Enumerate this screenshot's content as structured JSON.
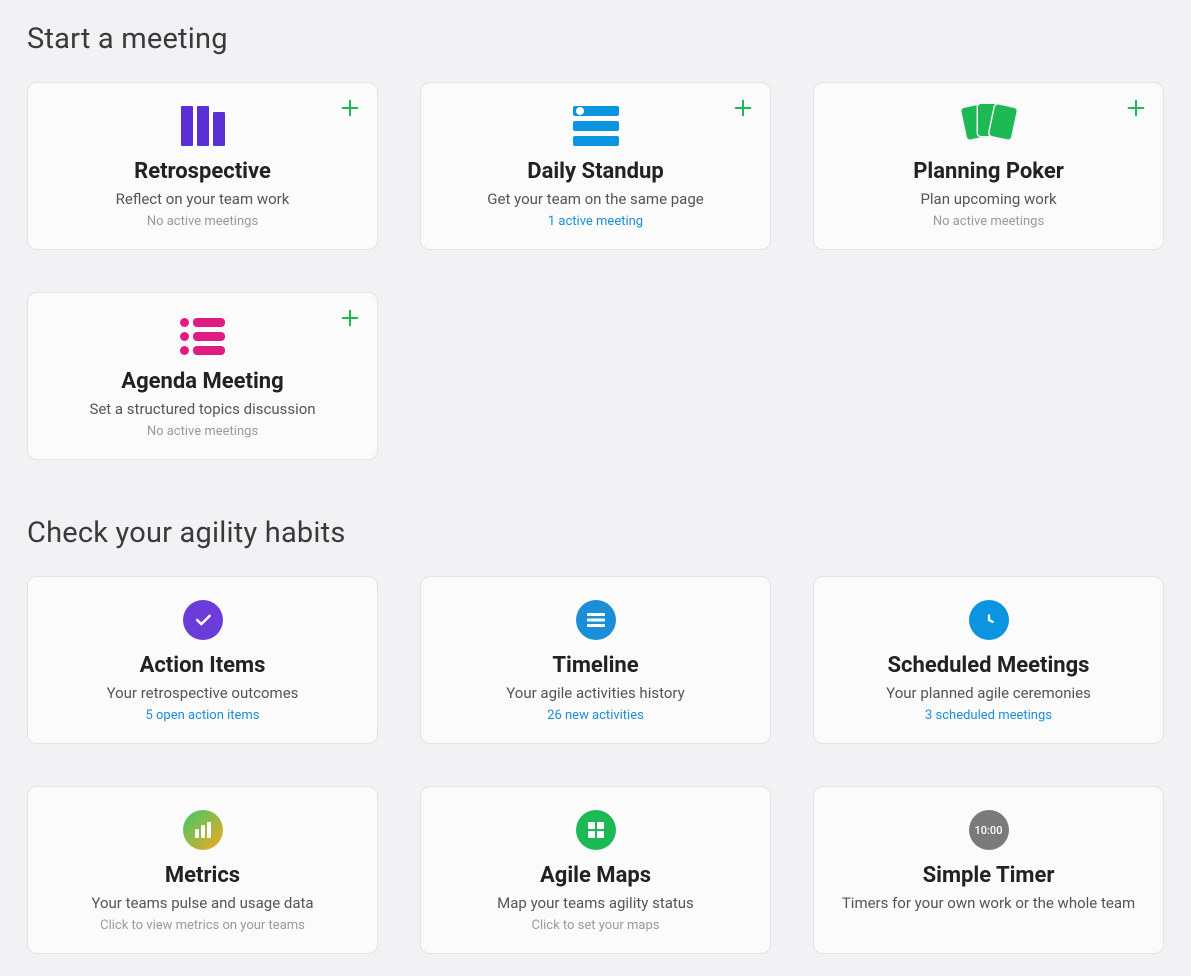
{
  "sections": {
    "start": {
      "title": "Start a meeting",
      "cards": [
        {
          "title": "Retrospective",
          "subtitle": "Reflect on your team work",
          "meta": "No active meetings",
          "meta_link": false
        },
        {
          "title": "Daily Standup",
          "subtitle": "Get your team on the same page",
          "meta": "1 active meeting",
          "meta_link": true
        },
        {
          "title": "Planning Poker",
          "subtitle": "Plan upcoming work",
          "meta": "No active meetings",
          "meta_link": false
        },
        {
          "title": "Agenda Meeting",
          "subtitle": "Set a structured topics discussion",
          "meta": "No active meetings",
          "meta_link": false
        }
      ]
    },
    "habits": {
      "title": "Check your agility habits",
      "cards": [
        {
          "title": "Action Items",
          "subtitle": "Your retrospective outcomes",
          "meta": "5 open action items",
          "meta_link": true
        },
        {
          "title": "Timeline",
          "subtitle": "Your agile activities history",
          "meta": "26 new activities",
          "meta_link": true
        },
        {
          "title": "Scheduled Meetings",
          "subtitle": "Your planned agile ceremonies",
          "meta": "3 scheduled meetings",
          "meta_link": true
        },
        {
          "title": "Metrics",
          "subtitle": "Your teams pulse and usage data",
          "meta": "Click to view metrics on your teams",
          "meta_link": false
        },
        {
          "title": "Agile Maps",
          "subtitle": "Map your teams agility status",
          "meta": "Click to set your maps",
          "meta_link": false
        },
        {
          "title": "Simple Timer",
          "subtitle": "Timers for your own work or the whole team",
          "meta": "",
          "meta_link": false,
          "timer_label": "10:00"
        }
      ]
    }
  },
  "colors": {
    "accent_green": "#1db954",
    "accent_blue": "#1a8fd8",
    "accent_purple": "#6b3cd9"
  }
}
